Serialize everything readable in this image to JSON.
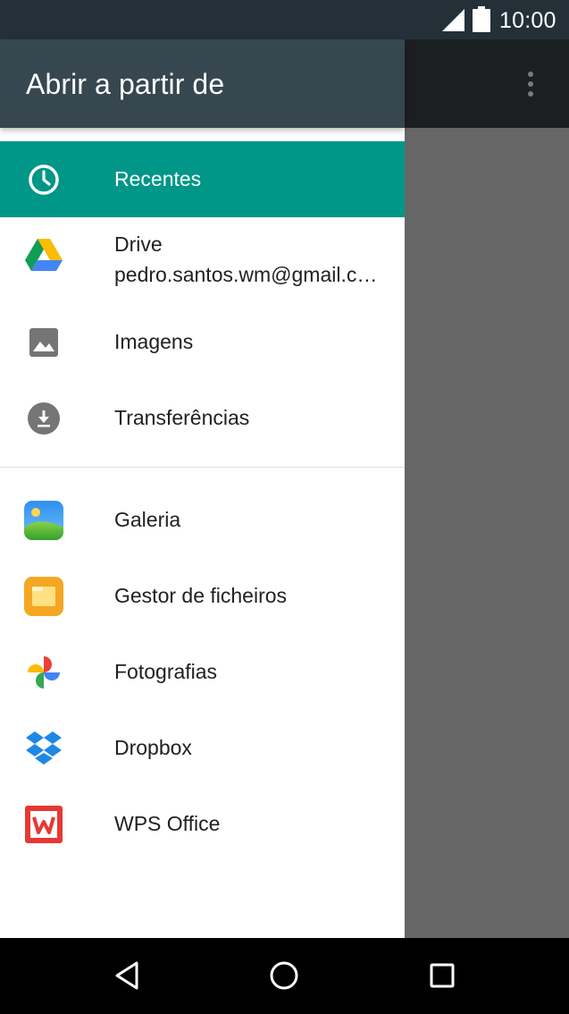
{
  "status_bar": {
    "time": "10:00"
  },
  "drawer": {
    "title": "Abrir a partir de",
    "items": [
      {
        "label": "Recentes",
        "icon": "clock-icon",
        "selected": true
      },
      {
        "label": "Drive",
        "sublabel": "pedro.santos.wm@gmail.com",
        "icon": "google-drive-icon"
      },
      {
        "label": "Imagens",
        "icon": "image-icon"
      },
      {
        "label": "Transferências",
        "icon": "download-icon"
      },
      {
        "label": "Galeria",
        "icon": "gallery-app-icon"
      },
      {
        "label": "Gestor de ficheiros",
        "icon": "file-manager-icon"
      },
      {
        "label": "Fotografias",
        "icon": "google-photos-icon"
      },
      {
        "label": "Dropbox",
        "icon": "dropbox-icon"
      },
      {
        "label": "WPS Office",
        "icon": "wps-office-icon"
      }
    ]
  },
  "colors": {
    "status_bar": "#243038",
    "drawer_header": "#37474f",
    "selected_item": "#009688",
    "scrim": "#666666"
  }
}
